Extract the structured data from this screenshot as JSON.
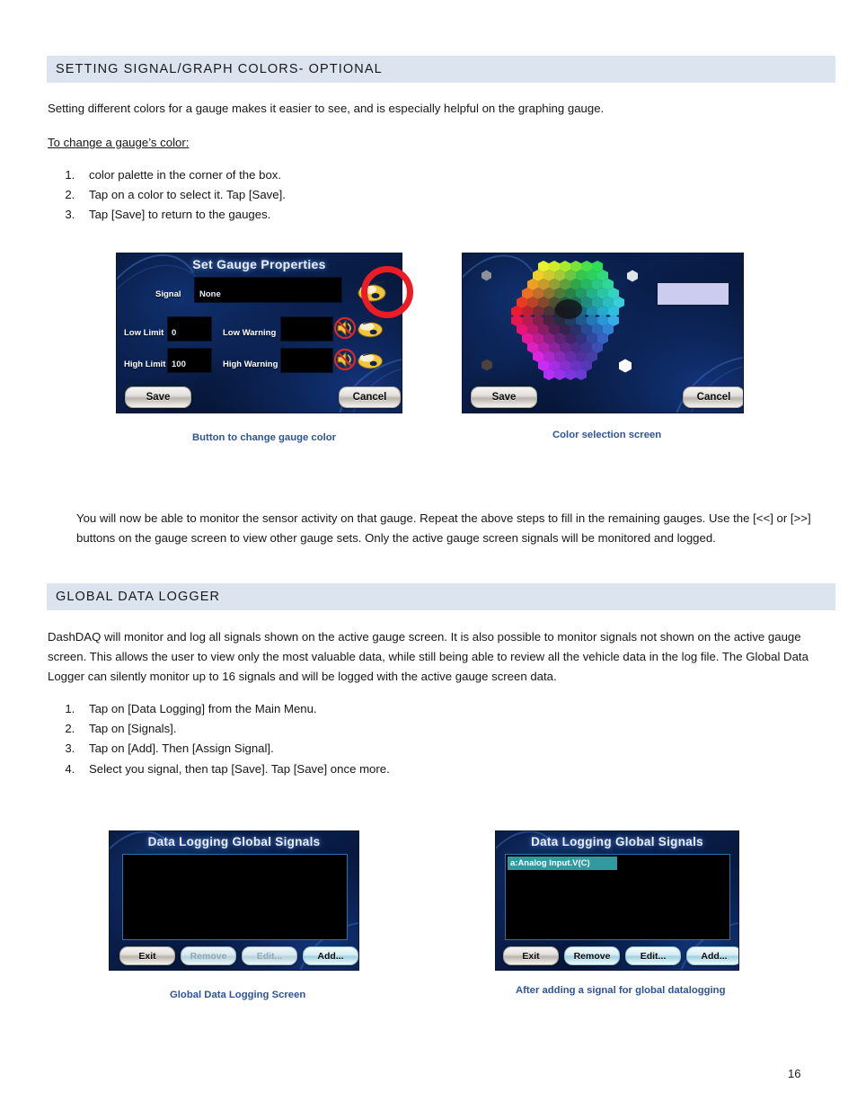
{
  "document": {
    "page_number": "16",
    "accent_heading_bg": "#dce5ef",
    "caption_color": "#2e5496",
    "annotation_color": "#ec1c24"
  },
  "section1": {
    "heading": "SETTING SIGNAL/GRAPH COLORS- OPTIONAL",
    "intro": "Setting different colors for a gauge makes it easier to see, and is especially helpful on the graphing gauge.",
    "subhead": "To change a gauge’s color:",
    "steps": [
      "color palette in the corner of the box.",
      "Tap on a color to select it. Tap [Save].",
      "Tap [Save] to return to the gauges."
    ],
    "after_text": "You will now be able to monitor the sensor activity on that gauge.  Repeat the above steps to fill in the remaining gauges.  Use the [<<] or [>>] buttons on the gauge screen to view other gauge sets.  Only the active gauge screen signals will be monitored and logged."
  },
  "figure1": {
    "caption": "Button to change gauge color",
    "title": "Set Gauge Properties",
    "fields": [
      {
        "label": "Signal",
        "value": "None"
      },
      {
        "label": "Low Limit",
        "value": "0"
      },
      {
        "label": "Low Warning",
        "value": ""
      },
      {
        "label": "High Limit",
        "value": "100"
      },
      {
        "label": "High Warning",
        "value": ""
      }
    ],
    "save_label": "Save",
    "cancel_label": "Cancel"
  },
  "figure2": {
    "caption": "Color selection screen",
    "save_label": "Save",
    "cancel_label": "Cancel",
    "preview_color": "#ccccf0"
  },
  "section2": {
    "heading": "GLOBAL DATA LOGGER",
    "intro": "DashDAQ will monitor and log all signals shown on the active gauge screen.  It is also possible to monitor signals not shown on the active gauge screen.  This allows the user to view only the most valuable data, while still being able to review all the vehicle data in the log file.  The Global Data Logger can silently monitor up to 16 signals and will be logged with the active gauge screen data.",
    "steps": [
      "Tap on [Data Logging] from the Main Menu.",
      "Tap on [Signals].",
      "Tap on [Add]. Then [Assign Signal].",
      "Select you signal, then tap [Save]. Tap [Save] once more."
    ]
  },
  "figure3": {
    "caption": "Global Data Logging Screen",
    "title": "Data Logging Global Signals",
    "signals": [],
    "buttons": [
      {
        "label": "Exit",
        "enabled": true
      },
      {
        "label": "Remove",
        "enabled": false
      },
      {
        "label": "Edit...",
        "enabled": false
      },
      {
        "label": "Add...",
        "enabled": true
      }
    ]
  },
  "figure4": {
    "caption": "After adding a signal for global datalogging",
    "title": "Data Logging Global Signals",
    "signals": [
      "a:Analog Input.V(C)"
    ],
    "buttons": [
      {
        "label": "Exit",
        "enabled": true
      },
      {
        "label": "Remove",
        "enabled": true
      },
      {
        "label": "Edit...",
        "enabled": true
      },
      {
        "label": "Add...",
        "enabled": true
      }
    ]
  }
}
